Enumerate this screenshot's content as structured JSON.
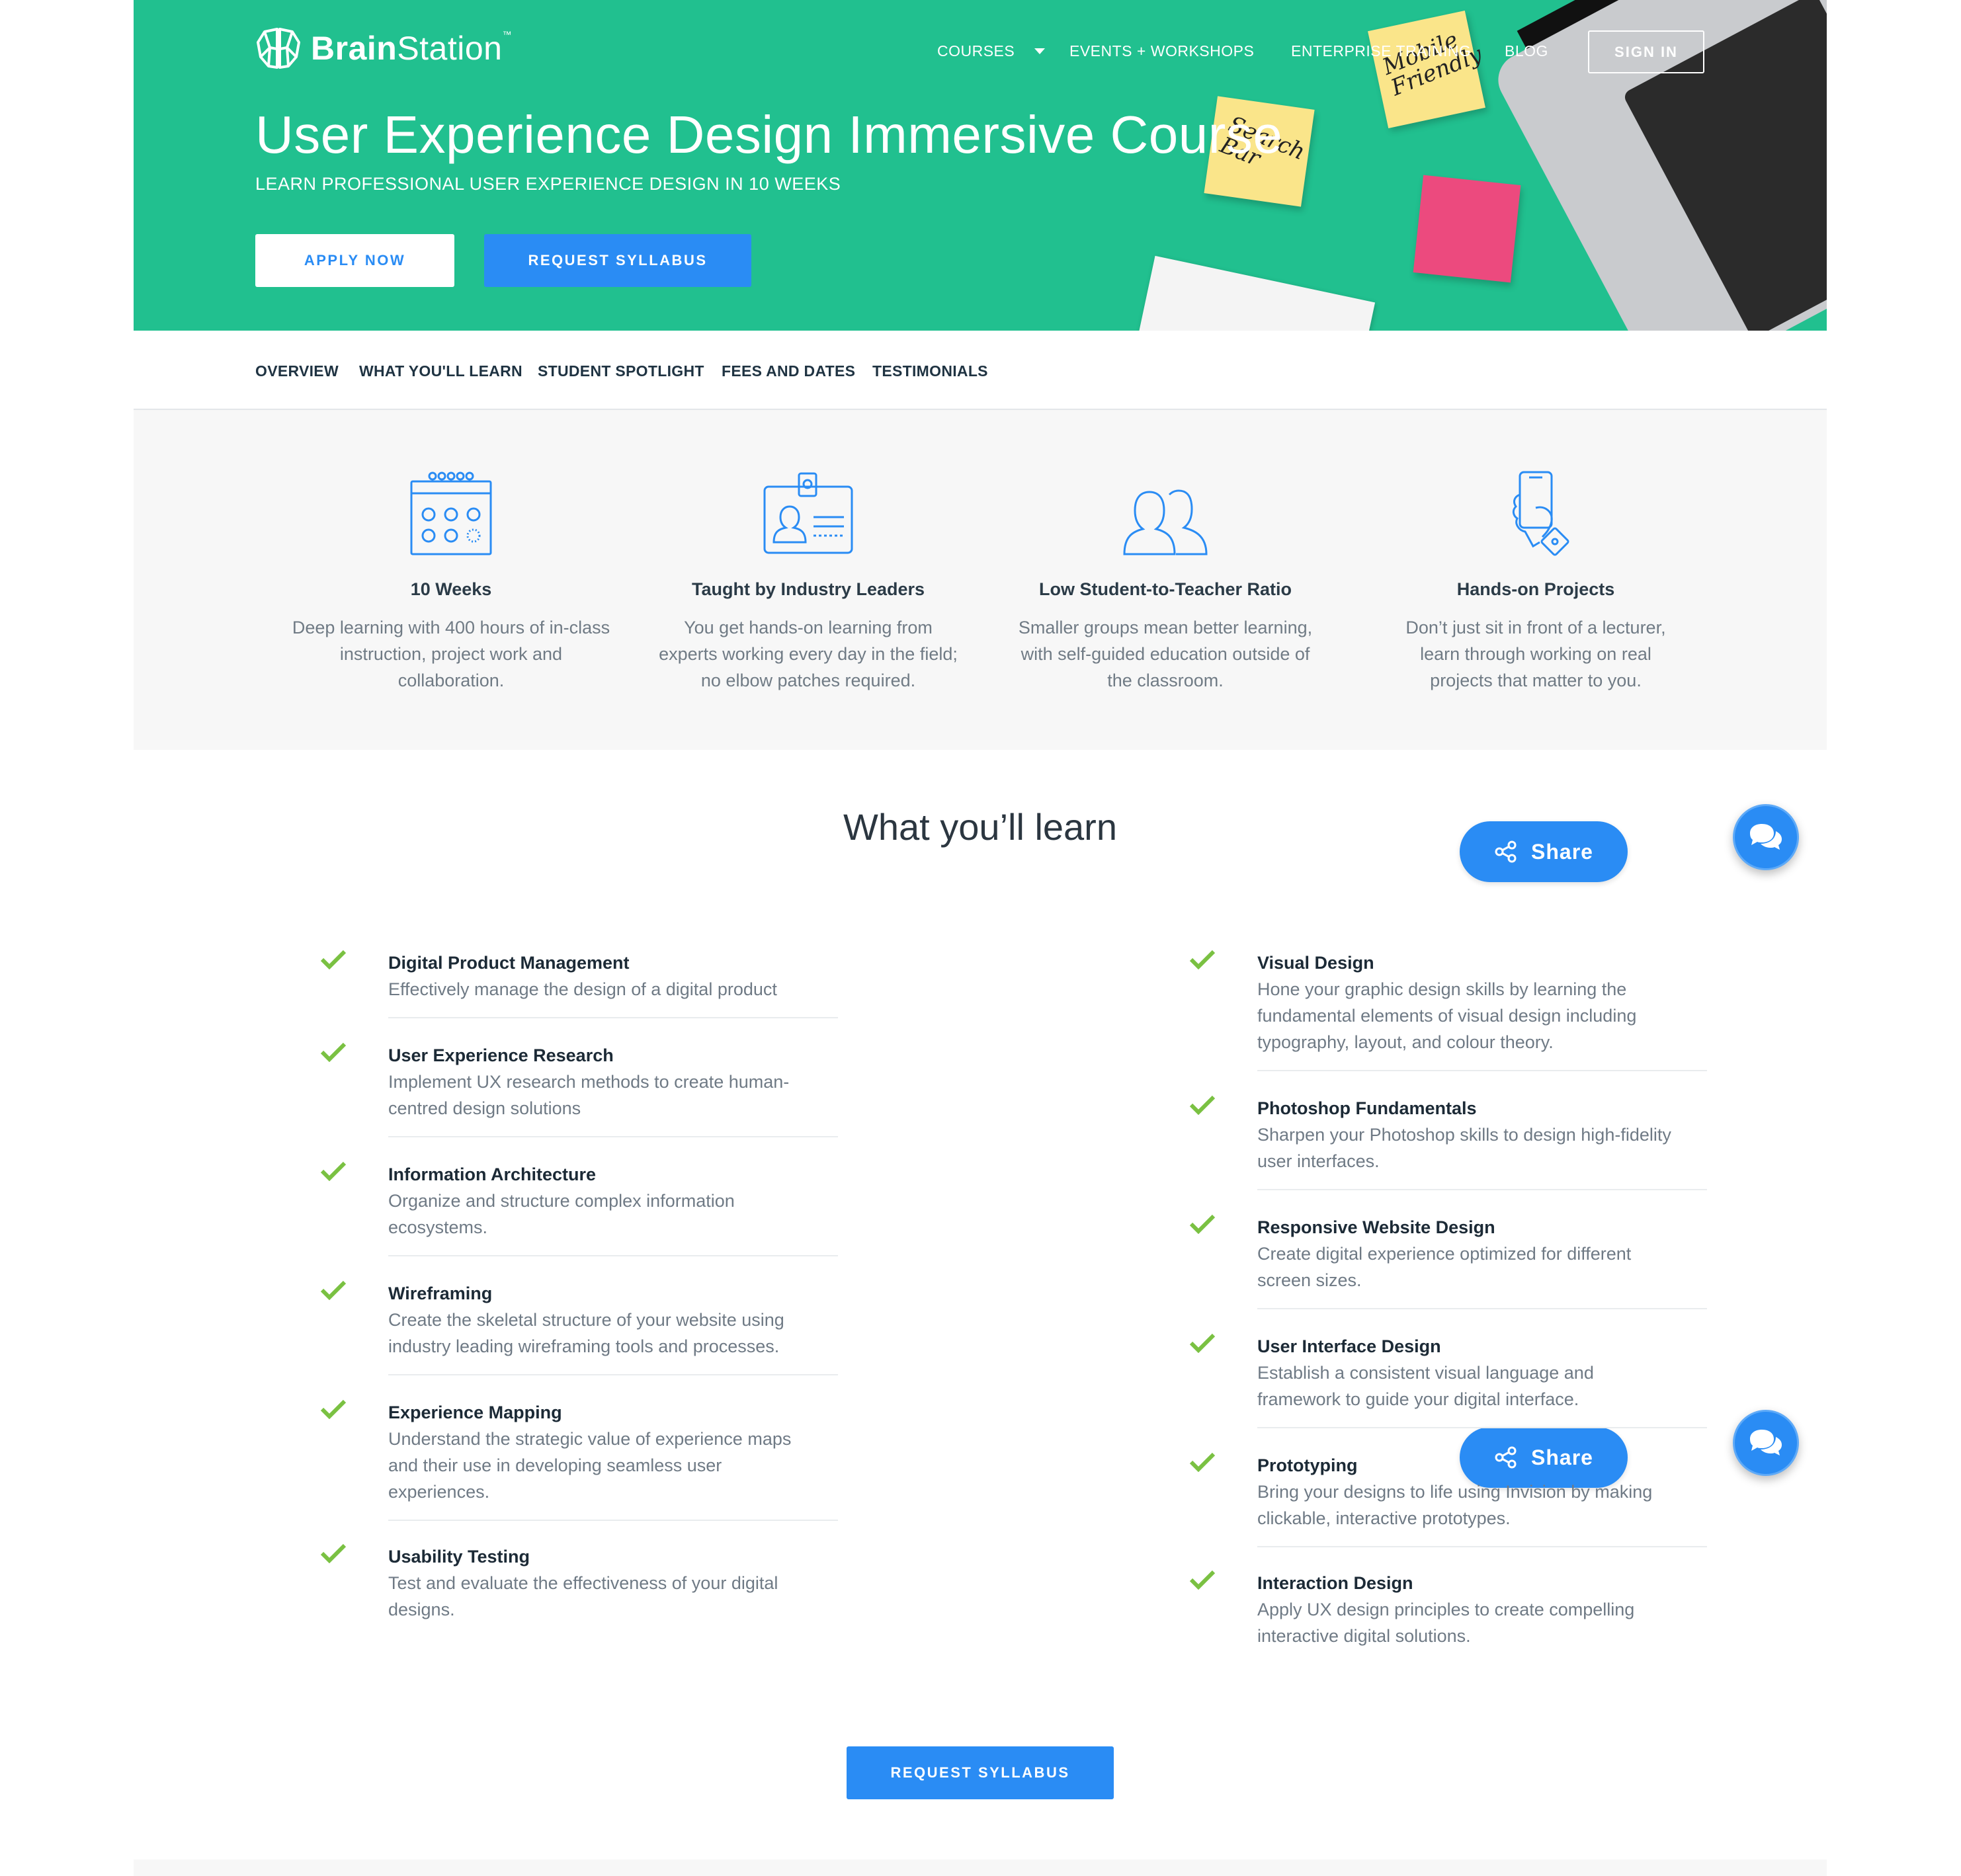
{
  "brand": {
    "name_bold": "Brain",
    "name_light": "Station",
    "trademark": "™"
  },
  "nav": {
    "courses": "COURSES",
    "events": "EVENTS + WORKSHOPS",
    "enterprise": "ENTERPRISE TRAINING",
    "blog": "BLOG",
    "sign_in": "SIGN IN"
  },
  "hero": {
    "title": "User Experience Design Immersive Course",
    "subtitle": "LEARN PROFESSIONAL USER EXPERIENCE DESIGN IN 10 WEEKS",
    "apply_label": "APPLY NOW",
    "syllabus_label": "REQUEST SYLLABUS",
    "background_color": "#21c08f",
    "sticky_notes": [
      "Mobile Friendly",
      "Search Bar"
    ]
  },
  "subnav": {
    "items": [
      "OVERVIEW",
      "WHAT YOU'LL LEARN",
      "STUDENT SPOTLIGHT",
      "FEES AND DATES",
      "TESTIMONIALS"
    ]
  },
  "features": [
    {
      "icon": "calendar-icon",
      "title": "10 Weeks",
      "lines": [
        "Deep learning with 400 hours of in-class",
        "instruction, project work and",
        "collaboration."
      ]
    },
    {
      "icon": "id-badge-icon",
      "title": "Taught by Industry Leaders",
      "lines": [
        "You get hands-on learning from",
        "experts working every day in the field;",
        "no elbow patches required."
      ]
    },
    {
      "icon": "people-icon",
      "title": "Low Student-to-Teacher Ratio",
      "lines": [
        "Smaller groups mean better learning,",
        "with self-guided education outside of",
        "the classroom."
      ]
    },
    {
      "icon": "hand-phone-icon",
      "title": "Hands-on Projects",
      "lines": [
        "Don’t just sit in front of a lecturer,",
        "learn through working on real",
        "projects that matter to you."
      ]
    }
  ],
  "learn": {
    "title": "What you’ll learn",
    "share_label": "Share",
    "left": [
      {
        "name": "Digital Product Management",
        "lines": [
          "Effectively manage the design of a digital product"
        ]
      },
      {
        "name": "User Experience Research",
        "lines": [
          "Implement UX research methods to create human-",
          "centred design solutions"
        ]
      },
      {
        "name": "Information Architecture",
        "lines": [
          "Organize and structure complex information",
          "ecosystems."
        ]
      },
      {
        "name": "Wireframing",
        "lines": [
          "Create the skeletal structure of your website using",
          "industry leading wireframing tools and processes."
        ]
      },
      {
        "name": "Experience Mapping",
        "lines": [
          "Understand the strategic value of experience maps",
          "and their use in developing seamless user",
          "experiences."
        ]
      },
      {
        "name": "Usability Testing",
        "lines": [
          "Test and evaluate the effectiveness of your digital",
          "designs."
        ]
      }
    ],
    "right": [
      {
        "name": "Visual Design",
        "lines": [
          "Hone your graphic design skills by learning the",
          "fundamental elements of visual design including",
          "typography, layout, and colour theory."
        ]
      },
      {
        "name": "Photoshop Fundamentals",
        "lines": [
          "Sharpen your Photoshop skills to design high-fidelity",
          "user interfaces."
        ]
      },
      {
        "name": "Responsive Website Design",
        "lines": [
          "Create digital experience optimized for different",
          "screen sizes."
        ]
      },
      {
        "name": "User Interface Design",
        "lines": [
          "Establish a consistent visual language and",
          "framework to guide your digital interface."
        ]
      },
      {
        "name": "Prototyping",
        "lines": [
          "Bring your designs to life using Invision by making",
          "clickable, interactive prototypes."
        ]
      },
      {
        "name": "Interaction Design",
        "lines": [
          "Apply UX design principles to create compelling",
          "interactive digital solutions."
        ]
      }
    ],
    "bottom_button": "REQUEST SYLLABUS"
  },
  "colors": {
    "accent_blue": "#2a8cf4",
    "check_green": "#7ac142",
    "hero_green": "#21c08f"
  }
}
